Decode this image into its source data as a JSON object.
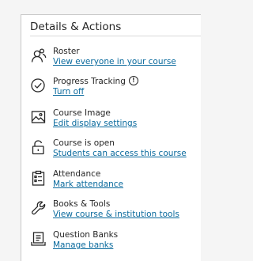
{
  "panel": {
    "title": "Details & Actions"
  },
  "items": [
    {
      "name": "roster",
      "icon": "roster-icon",
      "label": "Roster",
      "link": "View everyone in your course"
    },
    {
      "name": "progress-tracking",
      "icon": "progress-check-icon",
      "label": "Progress Tracking",
      "link": "Turn off",
      "badge": "!"
    },
    {
      "name": "course-image",
      "icon": "image-icon",
      "label": "Course Image",
      "link": "Edit display settings"
    },
    {
      "name": "course-status",
      "icon": "unlock-icon",
      "label": "Course is open",
      "link": "Students can access this course"
    },
    {
      "name": "attendance",
      "icon": "attendance-icon",
      "label": "Attendance",
      "link": "Mark attendance"
    },
    {
      "name": "books-tools",
      "icon": "wrench-icon",
      "label": "Books & Tools",
      "link": "View course & institution tools"
    },
    {
      "name": "question-banks",
      "icon": "question-bank-icon",
      "label": "Question Banks",
      "link": "Manage banks"
    }
  ],
  "colors": {
    "link": "#0a6a9d",
    "text": "#262626",
    "panel_bg": "#ffffff",
    "page_bg": "#f5f5f5"
  }
}
